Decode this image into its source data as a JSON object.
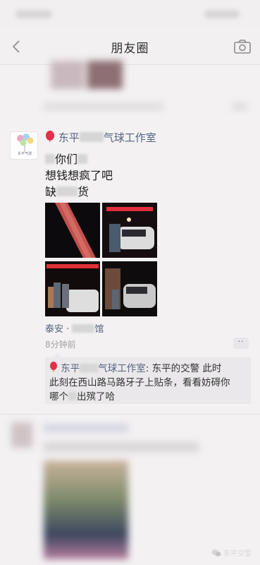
{
  "nav": {
    "title": "朋友圈",
    "back_icon": "chevron-left-icon",
    "camera_icon": "camera-icon"
  },
  "post": {
    "author_prefix": "东平",
    "author_suffix": "气球工作室",
    "lines": [
      "你们",
      "想钱想疯了吧",
      "缺",
      "货"
    ],
    "avatar_text": "东平气球",
    "location_city": "泰安 · ",
    "location_place_end": "馆",
    "time": "8分钟前",
    "more_label": "··",
    "comment": {
      "author_prefix": "东平",
      "author_suffix": "气球工作室",
      "colon": ": ",
      "line1": "东平的交警 此时",
      "line2": "此刻在西山路马路牙子上贴条，看看妨碍你",
      "line3_start": "哪个",
      "line3_end": "出殡了哈"
    }
  },
  "watermark": {
    "label": "东平交警",
    "icon": "wechat-icon"
  },
  "colors": {
    "link_blue": "#55627f",
    "background": "#f3f1f2",
    "balloon_red": "#e0304a"
  }
}
